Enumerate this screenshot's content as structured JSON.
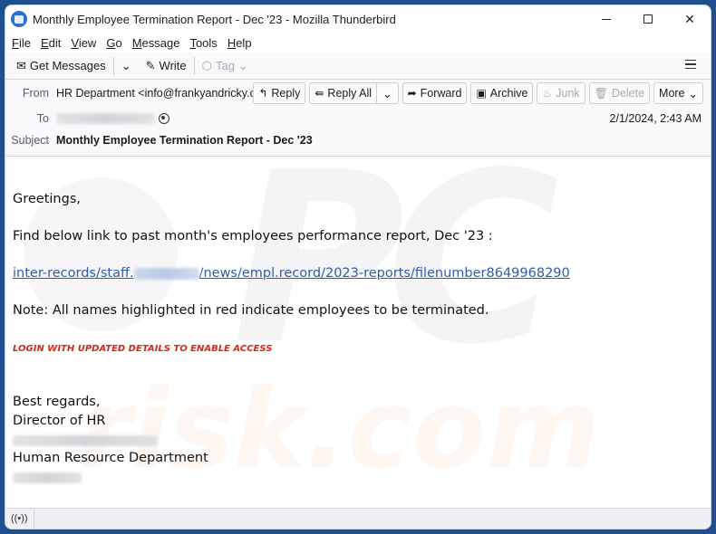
{
  "window": {
    "title": "Monthly Employee Termination Report - Dec '23 - Mozilla Thunderbird",
    "app_icon": "thunderbird-icon",
    "controls": [
      "minimize-icon",
      "maximize-icon",
      "close-icon"
    ]
  },
  "menubar": {
    "items": [
      {
        "label": "File",
        "accel": "F",
        "rest": "ile"
      },
      {
        "label": "Edit",
        "accel": "E",
        "rest": "dit"
      },
      {
        "label": "View",
        "accel": "V",
        "rest": "iew"
      },
      {
        "label": "Go",
        "accel": "G",
        "rest": "o"
      },
      {
        "label": "Message",
        "accel": "M",
        "rest": "essage"
      },
      {
        "label": "Tools",
        "accel": "T",
        "rest": "ools"
      },
      {
        "label": "Help",
        "accel": "H",
        "rest": "elp"
      }
    ]
  },
  "toolbar": {
    "get_messages": "Get Messages",
    "write": "Write",
    "tag": "Tag",
    "menu_icon": "hamburger-menu-icon"
  },
  "header": {
    "from_label": "From",
    "from_value": "HR Department <info@frankyandricky.cc>",
    "to_label": "To",
    "to_value_redacted": true,
    "subject_label": "Subject",
    "subject": "Monthly Employee Termination Report - Dec '23",
    "date": "2/1/2024, 2:43 AM",
    "actions": {
      "reply": "Reply",
      "reply_all": "Reply All",
      "forward": "Forward",
      "archive": "Archive",
      "junk": "Junk",
      "delete": "Delete",
      "more": "More"
    }
  },
  "body": {
    "greeting": "Greetings,",
    "line1": "Find below link to past month's employees performance report, Dec '23 :",
    "link_prefix": "inter-records/staff.",
    "link_suffix": "/news/empl.record/2023-reports/filenumber8649968290",
    "note": "Note: All names highlighted in red indicate employees to be terminated.",
    "alert": "LOGIN WITH UPDATED DETAILS TO ENABLE ACCESS",
    "sign_off": "Best regards,",
    "signer_title": "Director of HR",
    "department": "Human Resource Department",
    "watermark_top": "PC",
    "watermark_bottom": "risk.com"
  },
  "statusbar": {
    "icon": "online-status-icon"
  }
}
